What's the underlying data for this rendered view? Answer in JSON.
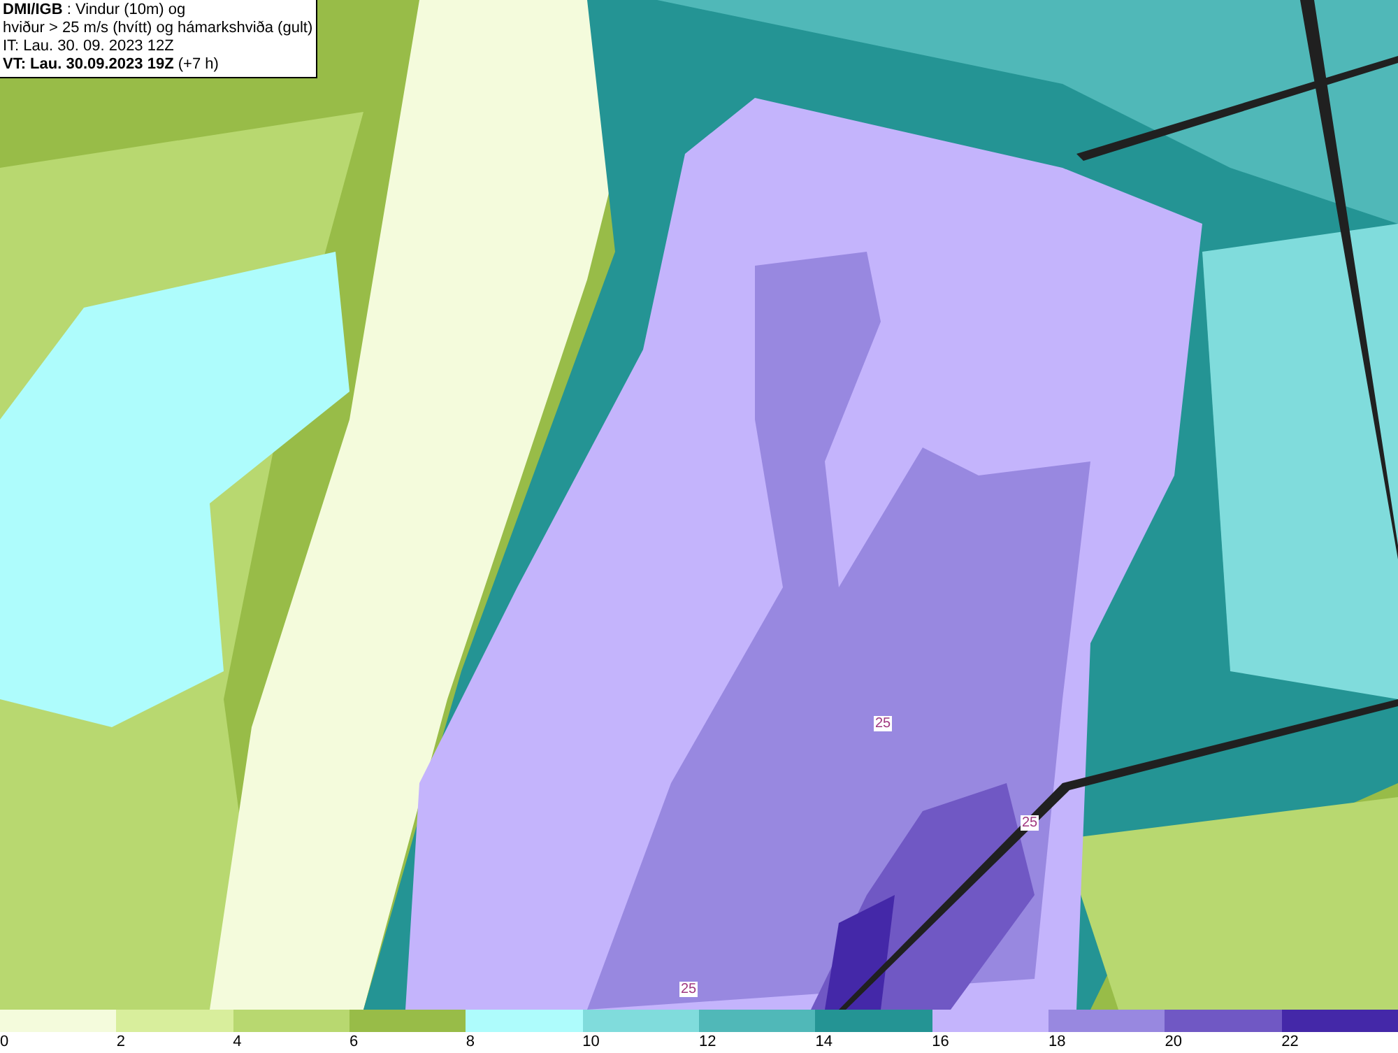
{
  "header": {
    "lines": [
      "**DMI/IGB** : Vindur (10m) og",
      "hviður > 25 m/s (hvítt) og hámarkshviða (gult)",
      "IT: Lau. 30. 09. 2023 12Z",
      "**VT: Lau. 30.09.2023 19Z** (+7 h)"
    ]
  },
  "map": {
    "contour_labels": [
      "25",
      "25",
      "25"
    ]
  },
  "legend": [
    {
      "label": "0",
      "color": "#f4fbdc"
    },
    {
      "label": "2",
      "color": "#d8ee9c"
    },
    {
      "label": "4",
      "color": "#b8d870"
    },
    {
      "label": "6",
      "color": "#98bc48"
    },
    {
      "label": "8",
      "color": "#aefcfc"
    },
    {
      "label": "10",
      "color": "#80dcdc"
    },
    {
      "label": "12",
      "color": "#50b8b8"
    },
    {
      "label": "14",
      "color": "#249494"
    },
    {
      "label": "16",
      "color": "#c4b4fc"
    },
    {
      "label": "18",
      "color": "#9888e0"
    },
    {
      "label": "20",
      "color": "#7058c4"
    },
    {
      "label": "22",
      "color": "#4428a8"
    }
  ]
}
